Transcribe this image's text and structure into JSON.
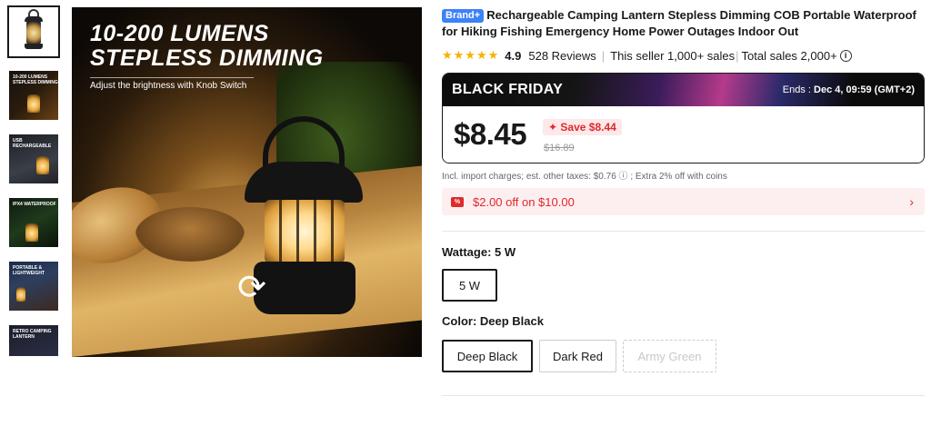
{
  "gallery": {
    "thumbnails": [
      {
        "text": ""
      },
      {
        "text": "10-200 LUMENS STEPLESS DIMMING"
      },
      {
        "text": "USB RECHARGEABLE"
      },
      {
        "text": "IPX4 WATERPROOF"
      },
      {
        "text": "PORTABLE & LIGHTWEIGHT"
      },
      {
        "text": "RETRO CAMPING LANTERN"
      }
    ],
    "main_headline_1": "10-200  LUMENS",
    "main_headline_2": "STEPLESS DIMMING",
    "main_subhead": "Adjust the brightness with Knob Switch"
  },
  "product": {
    "brand_badge": "Brand+",
    "title": "Rechargeable Camping Lantern Stepless Dimming COB Portable Waterproof for Hiking Fishing Emergency Home Power Outages Indoor Out",
    "stars": "★★★★★",
    "rating": "4.9",
    "reviews": "528 Reviews",
    "seller_sales": "This seller 1,000+ sales",
    "total_sales": "Total sales 2,000+"
  },
  "deal": {
    "label": "BLACK FRIDAY",
    "ends_prefix": "Ends : ",
    "ends_time": "Dec 4, 09:59 (GMT+2)",
    "price": "$8.45",
    "save": "Save $8.44",
    "original_price": "$16.89",
    "tax_note": "Incl. import charges; est. other taxes: $0.76 ⓘ ; Extra 2% off with coins"
  },
  "coupon": {
    "text": "$2.00 off on $10.00"
  },
  "wattage": {
    "label": "Wattage: ",
    "value": "5 W",
    "options": [
      "5 W"
    ]
  },
  "color": {
    "label": "Color: ",
    "value": "Deep Black",
    "options": [
      "Deep Black",
      "Dark Red",
      "Army Green"
    ]
  }
}
